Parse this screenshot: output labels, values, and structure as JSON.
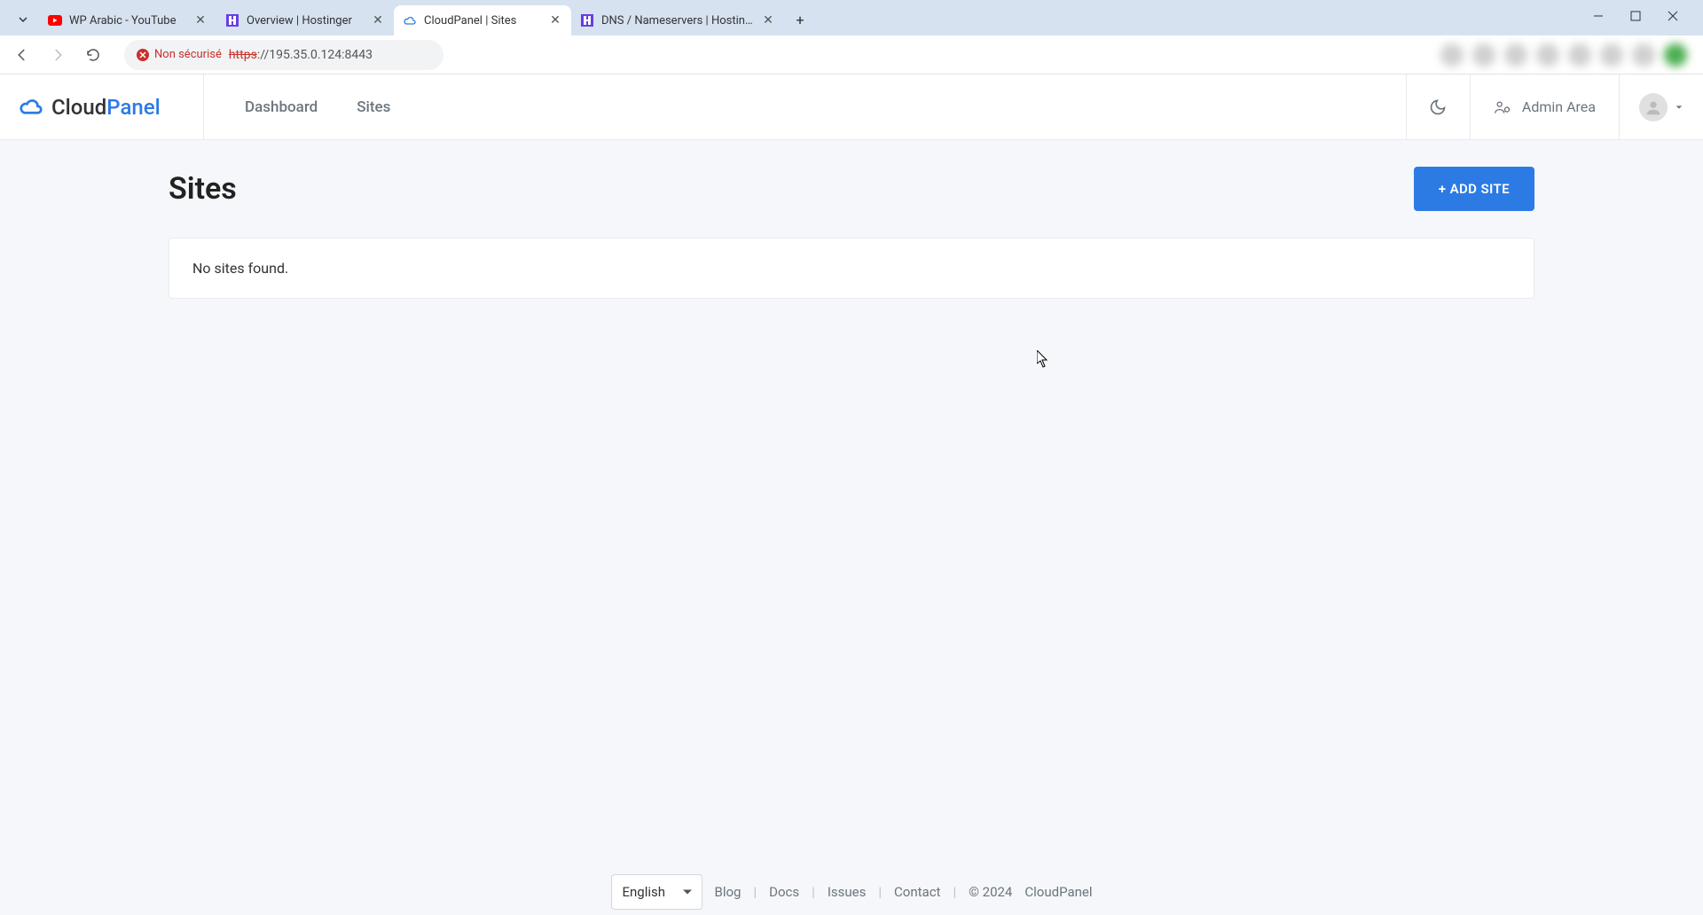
{
  "browser": {
    "tabs": [
      {
        "title": "WP Arabic - YouTube"
      },
      {
        "title": "Overview | Hostinger"
      },
      {
        "title": "CloudPanel | Sites"
      },
      {
        "title": "DNS / Nameservers | Hostinger"
      }
    ],
    "url_protocol": "https",
    "url_rest": "://195.35.0.124:8443",
    "insecure_label": "Non sécurisé"
  },
  "header": {
    "logo_cloud": "Cloud",
    "logo_panel": "Panel",
    "nav": {
      "dashboard": "Dashboard",
      "sites": "Sites"
    },
    "admin_area": "Admin Area"
  },
  "page": {
    "title": "Sites",
    "add_button": "+ ADD SITE",
    "empty": "No sites found."
  },
  "footer": {
    "language": "English",
    "links": {
      "blog": "Blog",
      "docs": "Docs",
      "issues": "Issues",
      "contact": "Contact"
    },
    "copyright": "© 2024",
    "brand": "CloudPanel"
  }
}
